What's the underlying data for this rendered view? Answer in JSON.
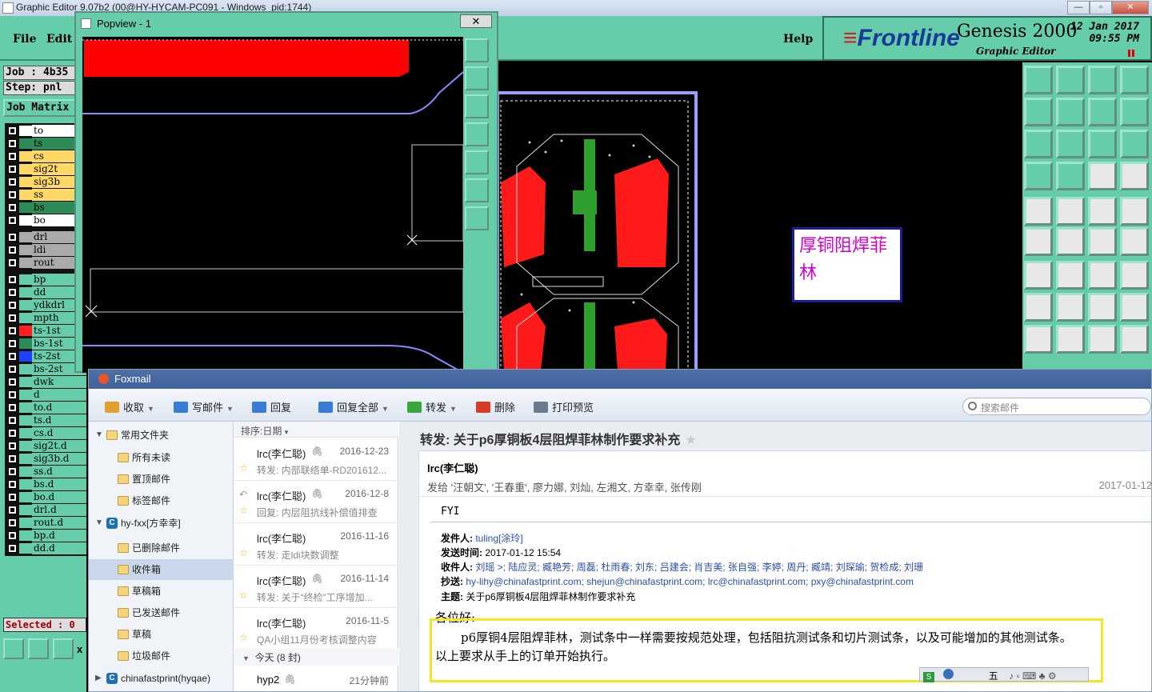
{
  "genesis": {
    "window_title": "Graphic Editor 9.07b2 (00@HY-HYCAM-PC091 - Windows_pid:1744)",
    "window_buttons": [
      "—",
      "▫",
      "✕"
    ],
    "menu": {
      "file": "File",
      "edit": "Edit",
      "help": "Help"
    },
    "logo": {
      "brand": "Frontline",
      "product": "Genesis 2000",
      "subtitle": "Graphic Editor",
      "date": "12 Jan 2017",
      "time": "09:55 PM"
    },
    "job": "Job : 4b35",
    "step": "Step: pnl",
    "matrix": "Job Matrix",
    "layers": [
      {
        "name": "to",
        "color": "#ffffff",
        "name_bg": "#ffffff"
      },
      {
        "name": "ts",
        "color": "#2e8b57",
        "name_bg": "#2e8b57"
      },
      {
        "name": "cs",
        "color": "#ffd966",
        "name_bg": "#ffd966"
      },
      {
        "name": "sig2t",
        "color": "#ffd966",
        "name_bg": "#ffd966"
      },
      {
        "name": "sig3b",
        "color": "#ffd966",
        "name_bg": "#ffd966"
      },
      {
        "name": "ss",
        "color": "#ffd966",
        "name_bg": "#ffd966"
      },
      {
        "name": "bs",
        "color": "#2e8b57",
        "name_bg": "#2e8b57"
      },
      {
        "name": "bo",
        "color": "#ffffff",
        "name_bg": "#ffffff"
      },
      {
        "name": "drl",
        "color": "#aaaaaa",
        "name_bg": "#aaaaaa"
      },
      {
        "name": "ldi",
        "color": "#aaaaaa",
        "name_bg": "#aaaaaa"
      },
      {
        "name": "rout",
        "color": "#aaaaaa",
        "name_bg": "#aaaaaa"
      },
      {
        "name": "bp",
        "color": "#66cdaa",
        "name_bg": "#66cdaa"
      },
      {
        "name": "dd",
        "color": "#66cdaa",
        "name_bg": "#66cdaa"
      },
      {
        "name": "ydkdrl",
        "color": "#66cdaa",
        "name_bg": "#66cdaa"
      },
      {
        "name": "mpth",
        "color": "#66cdaa",
        "name_bg": "#66cdaa"
      },
      {
        "name": "ts-1st",
        "color": "#ff2020",
        "name_bg": "#66cdaa"
      },
      {
        "name": "bs-1st",
        "color": "#2e8b57",
        "name_bg": "#66cdaa"
      },
      {
        "name": "ts-2st",
        "color": "#2040ff",
        "name_bg": "#66cdaa"
      },
      {
        "name": "bs-2st",
        "color": "#66cdaa",
        "name_bg": "#66cdaa"
      },
      {
        "name": "dwk",
        "color": "#66cdaa",
        "name_bg": "#66cdaa"
      },
      {
        "name": "d",
        "color": "#66cdaa",
        "name_bg": "#66cdaa"
      },
      {
        "name": "to.d",
        "color": "#66cdaa",
        "name_bg": "#66cdaa"
      },
      {
        "name": "ts.d",
        "color": "#66cdaa",
        "name_bg": "#66cdaa"
      },
      {
        "name": "cs.d",
        "color": "#66cdaa",
        "name_bg": "#66cdaa"
      },
      {
        "name": "sig2t.d",
        "color": "#66cdaa",
        "name_bg": "#66cdaa"
      },
      {
        "name": "sig3b.d",
        "color": "#66cdaa",
        "name_bg": "#66cdaa"
      },
      {
        "name": "ss.d",
        "color": "#66cdaa",
        "name_bg": "#66cdaa"
      },
      {
        "name": "bs.d",
        "color": "#66cdaa",
        "name_bg": "#66cdaa"
      },
      {
        "name": "bo.d",
        "color": "#66cdaa",
        "name_bg": "#66cdaa"
      },
      {
        "name": "drl.d",
        "color": "#66cdaa",
        "name_bg": "#66cdaa"
      },
      {
        "name": "rout.d",
        "color": "#66cdaa",
        "name_bg": "#66cdaa"
      },
      {
        "name": "bp.d",
        "color": "#66cdaa",
        "name_bg": "#66cdaa"
      },
      {
        "name": "dd.d",
        "color": "#66cdaa",
        "name_bg": "#66cdaa"
      }
    ],
    "selected": "Selected : 0",
    "x_label": "x",
    "note": "厚铜阻焊菲林"
  },
  "popview": {
    "title": "Popview - 1",
    "close": "✕"
  },
  "foxmail": {
    "title": "Foxmail",
    "toolbar": [
      {
        "label": "收取",
        "icon": "receive-icon",
        "color": "#e0a030",
        "dropdown": true
      },
      {
        "label": "写邮件",
        "icon": "compose-icon",
        "color": "#3a7bd5",
        "dropdown": true
      },
      {
        "label": "回复",
        "icon": "reply-icon",
        "color": "#3a7bd5",
        "dropdown": false
      },
      {
        "label": "回复全部",
        "icon": "reply-all-icon",
        "color": "#3a7bd5",
        "dropdown": true
      },
      {
        "label": "转发",
        "icon": "forward-icon",
        "color": "#3aa53a",
        "dropdown": true
      },
      {
        "label": "删除",
        "icon": "delete-icon",
        "color": "#d83a2a",
        "dropdown": false
      },
      {
        "label": "打印预览",
        "icon": "print-icon",
        "color": "#6a7b90",
        "dropdown": false
      }
    ],
    "search_placeholder": "搜索邮件",
    "folders": [
      {
        "label": "常用文件夹",
        "type": "group"
      },
      {
        "label": "所有未读",
        "type": "folder"
      },
      {
        "label": "置顶邮件",
        "type": "star"
      },
      {
        "label": "标签邮件",
        "type": "tag"
      },
      {
        "label": "hy-fxx[方幸幸]",
        "type": "account"
      },
      {
        "label": "已删除邮件",
        "type": "trash"
      },
      {
        "label": "收件箱",
        "type": "inbox",
        "selected": true
      },
      {
        "label": "草稿箱",
        "type": "draft"
      },
      {
        "label": "已发送邮件",
        "type": "sent"
      },
      {
        "label": "草稿",
        "type": "folder"
      },
      {
        "label": "垃圾邮件",
        "type": "folder"
      },
      {
        "label": "chinafastprint(hyqae)",
        "type": "account"
      }
    ],
    "sort_label": "排序:日期",
    "messages": [
      {
        "from": "lrc(李仁聪)",
        "date": "2016-12-23",
        "subject": "转发: 内部联络单-RD201612...",
        "attach": true,
        "replied": false
      },
      {
        "from": "lrc(李仁聪)",
        "date": "2016-12-8",
        "subject": "回复: 内层阻抗线补偿值排查",
        "attach": true,
        "replied": true
      },
      {
        "from": "lrc(李仁聪)",
        "date": "2016-11-16",
        "subject": "转发: 走ldi块数调整",
        "attach": false,
        "replied": false
      },
      {
        "from": "lrc(李仁聪)",
        "date": "2016-11-14",
        "subject": "转发: 关于“终检”工序增加...",
        "attach": true,
        "replied": false
      },
      {
        "from": "lrc(李仁聪)",
        "date": "2016-11-5",
        "subject": "QA小组11月份考核调整内容",
        "attach": false,
        "replied": false
      }
    ],
    "today_group": "今天 (8 封)",
    "last_item": {
      "from": "hyp2",
      "time": "21分钟前"
    },
    "reading": {
      "subject": "转发: 关于p6厚铜板4层阻焊菲林制作要求补充",
      "sender": "lrc(李仁聪)",
      "recipients_label": "发给 '汪朝文', '王春重', 廖力娜, 刘灿, 左湘文, 方幸幸, 张传刚",
      "date": "2017-01-12",
      "fyi": "FYI",
      "fwd": {
        "from_label": "发件人:",
        "from": "tuling[涂玲]",
        "sent_label": "发送时间:",
        "sent": "2017-01-12 15:54",
        "to_label": "收件人:",
        "to": "刘瑶 >; 陆应灵; 臧艳芳; 周磊; 杜雨春; 刘东; 吕建会; 肖吉美; 张自强; 李婷; 周丹; 臧靖; 刘琛瑜; 贺检成; 刘珊",
        "cc_label": "抄送:",
        "cc": "hy-lihy@chinafastprint.com; shejun@chinafastprint.com; lrc@chinafastprint.com; pxy@chinafastprint.com",
        "subj_label": "主题:",
        "subj": "关于p6厚铜板4层阻焊菲林制作要求补充"
      },
      "greeting": "各位好:",
      "body1": "p6厚铜4层阻焊菲林，测试条中一样需要按规范处理，包括阻抗测试条和切片测试条，以及可能增加的其他测试条。",
      "body2": "以上要求从手上的订单开始执行。"
    },
    "ime_label": "五"
  }
}
